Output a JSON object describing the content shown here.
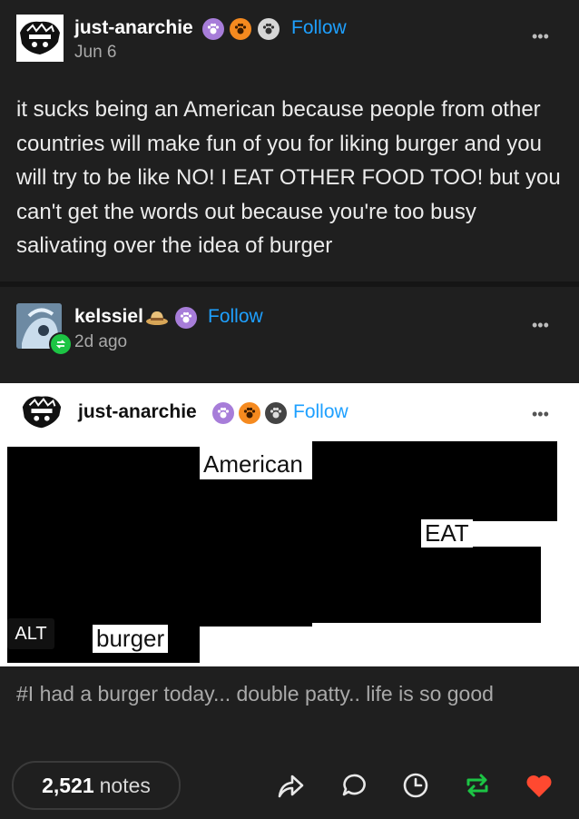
{
  "post": {
    "author": "just-anarchie",
    "follow_label": "Follow",
    "date": "Jun 6",
    "more_label": "•••",
    "body": "it sucks being an American because people from other countries will make fun of you for liking burger and you will try to be like NO! I EAT OTHER FOOD TOO! but you can't get the words out because you're too busy salivating over the idea of burger"
  },
  "reblog": {
    "author": "kelssiel",
    "follow_label": "Follow",
    "time": "2d ago",
    "more_label": "•••"
  },
  "screenshot": {
    "author": "just-anarchie",
    "follow_label": "Follow",
    "more_label": "•••",
    "words": {
      "american": "American",
      "eat": "EAT",
      "burger": "burger"
    },
    "alt_badge": "ALT"
  },
  "tags": {
    "text": "#I had a burger today... double patty.. life is so good"
  },
  "footer": {
    "notes_count": "2,521",
    "notes_label": "notes"
  },
  "colors": {
    "background": "#1f1f1f",
    "follow": "#1ea0ff",
    "reblog_green": "#1cc444",
    "like_red": "#ff4930",
    "badge_purple": "#a77dd9",
    "badge_orange": "#f58a1f"
  },
  "icons": [
    "share-icon",
    "reply-icon",
    "clock-icon",
    "reblog-icon",
    "heart-icon"
  ]
}
